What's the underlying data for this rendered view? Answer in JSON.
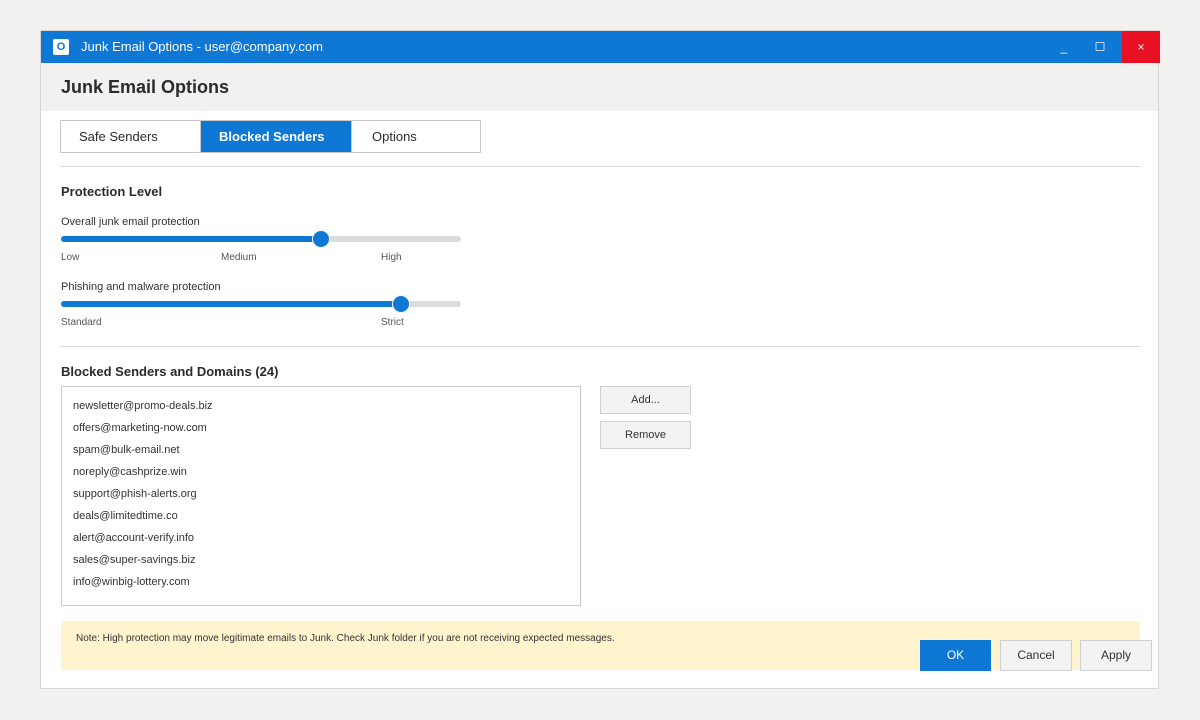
{
  "window": {
    "title": "Junk Email Options - user@company.com",
    "app_icon": "O",
    "minimize": "_",
    "maximize": "☐",
    "close": "×"
  },
  "header": {
    "title": "Junk Email Options"
  },
  "tabs": [
    {
      "label": "Safe Senders",
      "active": false
    },
    {
      "label": "Blocked Senders",
      "active": true
    },
    {
      "label": "Options",
      "active": false
    }
  ],
  "protection": {
    "title": "Protection Level",
    "overall": {
      "label": "Overall junk email protection",
      "level": 0.65,
      "ticks": [
        "Low",
        "Medium",
        "High"
      ]
    },
    "phishing": {
      "label": "Phishing and malware protection",
      "level": 0.85,
      "ticks": [
        "Standard",
        "Strict"
      ]
    }
  },
  "blocked": {
    "title": "Blocked Senders and Domains (24)",
    "items": [
      "newsletter@promo-deals.biz",
      "offers@marketing-now.com",
      "spam@bulk-email.net",
      "noreply@cashprize.win",
      "support@phish-alerts.org",
      "deals@limitedtime.co",
      "alert@account-verify.info",
      "sales@super-savings.biz",
      "info@winbig-lottery.com"
    ],
    "add_label": "Add...",
    "remove_label": "Remove"
  },
  "note": "Note: High protection may move legitimate emails to Junk. Check Junk folder if you are not receiving expected messages.",
  "footer": {
    "ok": "OK",
    "cancel": "Cancel",
    "apply": "Apply"
  },
  "colors": {
    "accent": "#0f78d4",
    "close": "#e81123",
    "note_bg": "#fff4ce"
  }
}
